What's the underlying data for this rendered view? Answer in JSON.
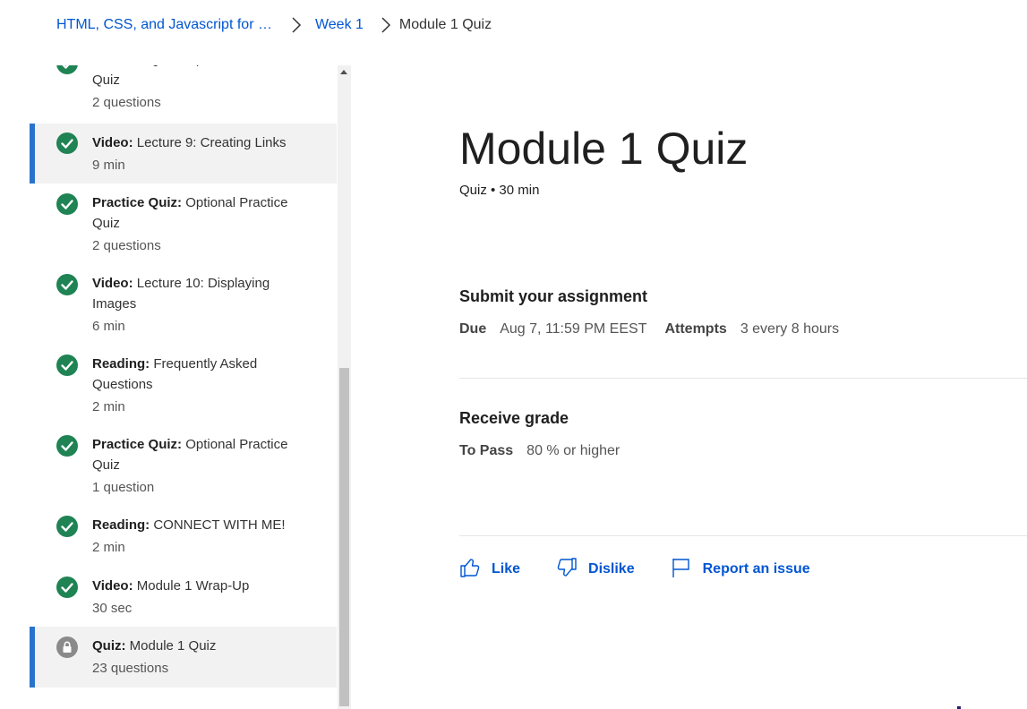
{
  "breadcrumb": {
    "course": "HTML, CSS, and Javascript for …",
    "week": "Week 1",
    "current": "Module 1 Quiz"
  },
  "sidebar": {
    "items": [
      {
        "type": "Practice Quiz:",
        "title": "Optional Practice Quiz",
        "sub": "2 questions",
        "status": "completed"
      },
      {
        "type": "Video:",
        "title": "Lecture 9: Creating Links",
        "sub": "9 min",
        "status": "completed"
      },
      {
        "type": "Practice Quiz:",
        "title": "Optional Practice Quiz",
        "sub": "2 questions",
        "status": "completed"
      },
      {
        "type": "Video:",
        "title": "Lecture 10: Displaying Images",
        "sub": "6 min",
        "status": "completed"
      },
      {
        "type": "Reading:",
        "title": "Frequently Asked Questions",
        "sub": "2 min",
        "status": "completed"
      },
      {
        "type": "Practice Quiz:",
        "title": "Optional Practice Quiz",
        "sub": "1 question",
        "status": "completed"
      },
      {
        "type": "Reading:",
        "title": "CONNECT WITH ME!",
        "sub": "2 min",
        "status": "completed"
      },
      {
        "type": "Video:",
        "title": "Module 1 Wrap-Up",
        "sub": "30 sec",
        "status": "completed"
      },
      {
        "type": "Quiz:",
        "title": "Module 1 Quiz",
        "sub": "23 questions",
        "status": "locked"
      }
    ]
  },
  "main": {
    "title": "Module 1 Quiz",
    "meta": "Quiz • 30 min",
    "submit": {
      "heading": "Submit your assignment",
      "due_label": "Due",
      "due_value": "Aug 7, 11:59 PM EEST",
      "attempts_label": "Attempts",
      "attempts_value": "3 every 8 hours"
    },
    "grade": {
      "heading": "Receive grade",
      "pass_label": "To Pass",
      "pass_value": "80 % or higher"
    },
    "actions": {
      "like": "Like",
      "dislike": "Dislike",
      "report": "Report an issue"
    }
  },
  "colors": {
    "link": "#0056d2",
    "complete_green": "#1f8354",
    "active_bar": "#2a73cc",
    "locked_gray": "#8a8a8a"
  },
  "icons": {
    "completed": "check-circle-icon",
    "locked": "lock-icon",
    "separator": "chevron-right-icon",
    "like": "thumbs-up-icon",
    "dislike": "thumbs-down-icon",
    "report": "flag-icon"
  }
}
